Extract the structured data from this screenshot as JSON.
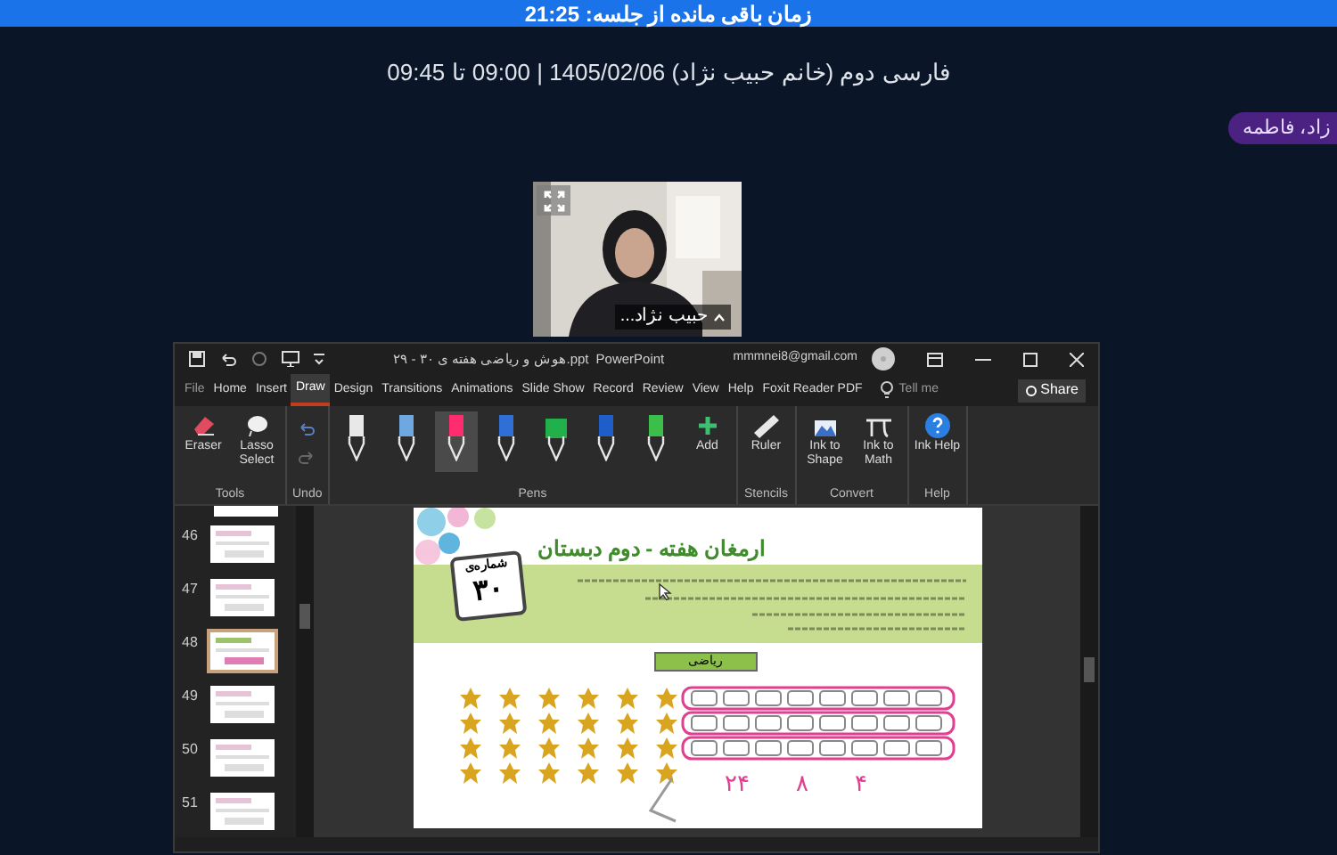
{
  "top_banner": {
    "text": "زمان باقی مانده از جلسه: 21:25"
  },
  "session_info": "فارسی دوم (خانم حبیب نژاد) 1405/02/06 | 09:00 تا 09:45",
  "participant_badge": "زاد، فاطمه",
  "video_tile": {
    "kind": "picture",
    "name": "حبیب نژاد..."
  },
  "shared_screen": {
    "title_bar": {
      "file_name": "ppt.هوش و ریاضی هفته ی ۳۰ - ۲۹",
      "app_name": "PowerPoint",
      "account": "mmmnei8@gmail.com"
    },
    "menu": [
      {
        "label": "File",
        "selected": false
      },
      {
        "label": "Home",
        "selected": false
      },
      {
        "label": "Insert",
        "selected": false
      },
      {
        "label": "Draw",
        "selected": true
      },
      {
        "label": "Design",
        "selected": false
      },
      {
        "label": "Transitions",
        "selected": false
      },
      {
        "label": "Animations",
        "selected": false
      },
      {
        "label": "Slide Show",
        "selected": false
      },
      {
        "label": "Record",
        "selected": false
      },
      {
        "label": "Review",
        "selected": false
      },
      {
        "label": "View",
        "selected": false
      },
      {
        "label": "Help",
        "selected": false
      },
      {
        "label": "Foxit Reader PDF",
        "selected": false
      }
    ],
    "tell_me": "Tell me",
    "share": "Share",
    "ribbon_groups": [
      {
        "label": "Tools",
        "tools": [
          {
            "kind": "eraser",
            "label": "Eraser"
          },
          {
            "kind": "lasso",
            "label": "Lasso Select"
          }
        ]
      },
      {
        "label": "Undo",
        "tools": [
          {
            "kind": "undo"
          },
          {
            "kind": "redo"
          }
        ]
      },
      {
        "label": "Pens",
        "tools": [
          {
            "kind": "pen",
            "color": "#e8e8e8",
            "selected": false
          },
          {
            "kind": "pen",
            "color": "#6fa8e0",
            "selected": false
          },
          {
            "kind": "pen",
            "color": "#ff2d6f",
            "selected": true
          },
          {
            "kind": "pen",
            "color": "#2f6fd6",
            "selected": false
          },
          {
            "kind": "highlighter",
            "color": "#22b04b",
            "selected": false
          },
          {
            "kind": "pen",
            "color": "#1f5ec8",
            "selected": false
          },
          {
            "kind": "pen",
            "color": "#3cbf4a",
            "selected": false
          },
          {
            "kind": "add",
            "label": "Add"
          }
        ]
      },
      {
        "label": "Stencils",
        "tools": [
          {
            "kind": "ruler",
            "label": "Ruler"
          }
        ]
      },
      {
        "label": "Convert",
        "tools": [
          {
            "kind": "ink_shape",
            "label": "Ink to Shape"
          },
          {
            "kind": "ink_math",
            "label": "Ink to Math"
          }
        ]
      },
      {
        "label": "Help",
        "tools": [
          {
            "kind": "help",
            "label": "Ink Help"
          }
        ]
      }
    ],
    "thumbnails": [
      {
        "number": "46",
        "selected": false
      },
      {
        "number": "47",
        "selected": false
      },
      {
        "number": "48",
        "selected": true
      },
      {
        "number": "49",
        "selected": false
      },
      {
        "number": "50",
        "selected": false
      },
      {
        "number": "51",
        "selected": false
      }
    ],
    "slide": {
      "title": "ارمغان هفته - دوم دبستان",
      "issue_label": "شماره‌ی",
      "issue_number": "۳۰",
      "subject": "ریاضی",
      "ink_numbers": [
        "۴",
        "۸",
        "۲۴"
      ]
    }
  }
}
